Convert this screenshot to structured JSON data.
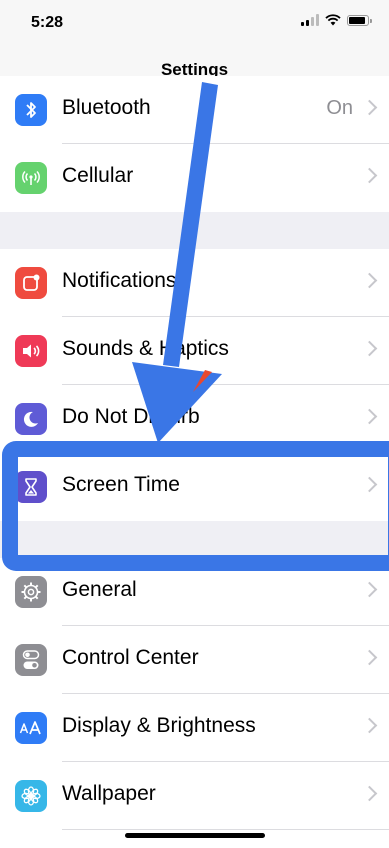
{
  "status_bar": {
    "time": "5:28"
  },
  "nav": {
    "title": "Settings"
  },
  "groups": [
    {
      "items": [
        {
          "label": "Bluetooth",
          "value": "On",
          "icon": "bluetooth-icon",
          "color": "#2f7cf6"
        },
        {
          "label": "Cellular",
          "value": "",
          "icon": "cellular-icon",
          "color": "#65d26e"
        }
      ]
    },
    {
      "items": [
        {
          "label": "Notifications",
          "icon": "notifications-icon",
          "color": "#ef4b3f"
        },
        {
          "label": "Sounds & Haptics",
          "icon": "speaker-icon",
          "color": "#ef3a57"
        },
        {
          "label": "Do Not Disturb",
          "icon": "moon-icon",
          "color": "#5f5bd6"
        },
        {
          "label": "Screen Time",
          "icon": "hourglass-icon",
          "color": "#5f4fcb"
        }
      ]
    },
    {
      "items": [
        {
          "label": "General",
          "icon": "gear-icon",
          "color": "#8e8e93"
        },
        {
          "label": "Control Center",
          "icon": "toggles-icon",
          "color": "#8e8e93"
        },
        {
          "label": "Display & Brightness",
          "icon": "text-size-icon",
          "color": "#2f7cf6"
        },
        {
          "label": "Wallpaper",
          "icon": "flower-icon",
          "color": "#36b7e8"
        }
      ]
    }
  ],
  "annotation": {
    "arrow_color": "#3a76e6",
    "highlight_color": "#3a76e6",
    "highlighted_item": "Screen Time"
  }
}
